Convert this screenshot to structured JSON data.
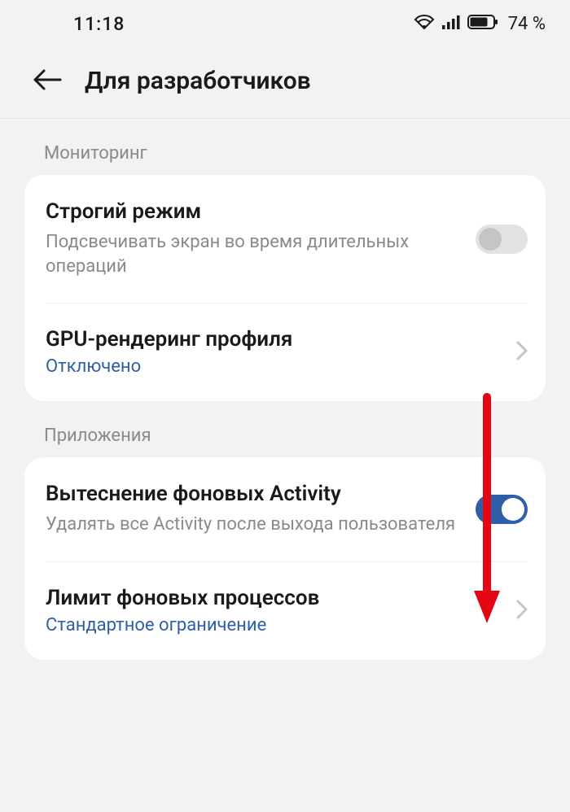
{
  "status": {
    "time": "11:18",
    "battery": "74 %"
  },
  "header": {
    "title": "Для разработчиков"
  },
  "sections": {
    "monitoring": {
      "label": "Мониторинг",
      "strict": {
        "title": "Строгий режим",
        "sub": "Подсвечивать экран во время длительных операций"
      },
      "gpu": {
        "title": "GPU-рендеринг профиля",
        "status": "Отключено"
      }
    },
    "apps": {
      "label": "Приложения",
      "bgactivity": {
        "title": "Вытеснение фоновых Activity",
        "sub": "Удалять все Activity после выхода пользователя"
      },
      "bglimit": {
        "title": "Лимит фоновых процессов",
        "status": "Стандартное ограничение"
      }
    }
  }
}
